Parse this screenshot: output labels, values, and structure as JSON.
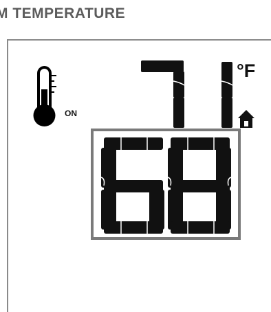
{
  "header": {
    "title": "M TEMPERATURE"
  },
  "thermostat": {
    "mode_label": "ON",
    "unit_label": "°F",
    "current_temperature": "71",
    "setpoint_temperature": "68",
    "icons": {
      "mode": "thermometer-icon",
      "location": "home-icon"
    }
  }
}
